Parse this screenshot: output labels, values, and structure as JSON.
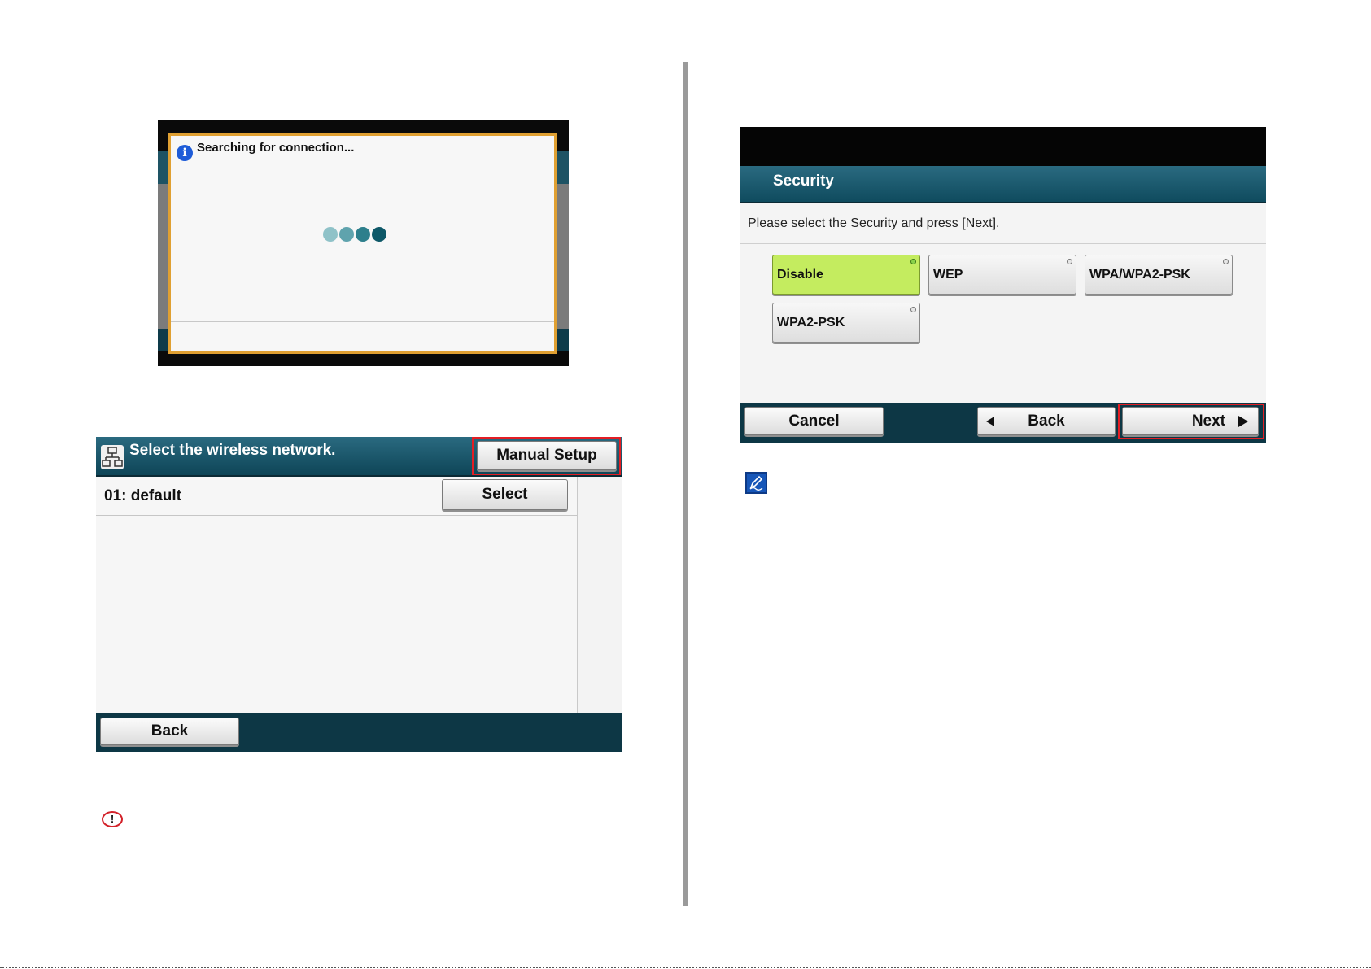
{
  "search_screen": {
    "message": "Searching for connection...",
    "info_icon": "info-icon",
    "dot_colors": [
      "#8fc2c8",
      "#5fa3ad",
      "#2d7f8c",
      "#0e5868"
    ]
  },
  "wireless_screen": {
    "title": "Select the wireless network.",
    "manual_setup_label": "Manual Setup",
    "networks": [
      {
        "label": "01: default",
        "select_label": "Select"
      }
    ],
    "back_label": "Back"
  },
  "security_screen": {
    "title": "Security",
    "instruction": "Please select the Security and press [Next].",
    "options": [
      {
        "label": "Disable",
        "selected": true
      },
      {
        "label": "WEP",
        "selected": false
      },
      {
        "label": "WPA/WPA2-PSK",
        "selected": false
      },
      {
        "label": "WPA2-PSK",
        "selected": false
      }
    ],
    "cancel_label": "Cancel",
    "back_label": "Back",
    "next_label": "Next"
  },
  "colors": {
    "header_teal": "#0e4557",
    "footer_teal": "#0d3745",
    "highlight_red": "#e31e24",
    "selected_green": "#c4ec5f",
    "dialog_border": "#e0a032"
  }
}
